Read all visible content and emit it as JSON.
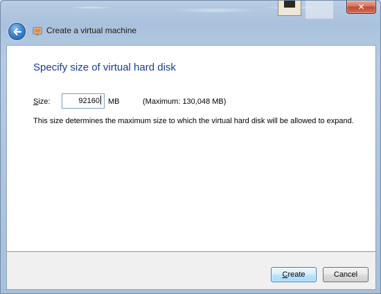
{
  "window": {
    "title": "Create a virtual machine",
    "close_label": "✕"
  },
  "page": {
    "heading": "Specify size of virtual hard disk"
  },
  "form": {
    "size_label": "Size:",
    "size_label_mnemonic": "S",
    "size_label_rest": "ize:",
    "size_value": "92160",
    "unit": "MB",
    "maximum": "(Maximum: 130,048 MB)",
    "description": "This size determines the maximum size to which the virtual hard disk will be allowed to expand."
  },
  "footer": {
    "create_label": "Create",
    "create_mnemonic": "C",
    "create_rest": "reate",
    "cancel_label": "Cancel"
  },
  "colors": {
    "heading": "#1e3a8e",
    "close_button": "#c04a31",
    "default_button_border": "#3c7fb1"
  },
  "icons": {
    "back": "back-arrow-icon",
    "title": "virtual-machine-icon",
    "close": "close-icon"
  }
}
